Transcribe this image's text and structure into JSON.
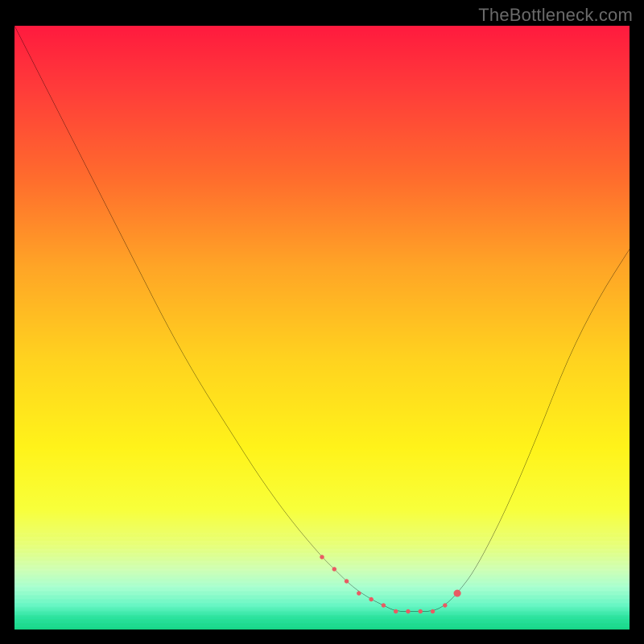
{
  "watermark": {
    "text": "TheBottleneck.com"
  },
  "chart_data": {
    "type": "line",
    "title": "",
    "xlabel": "",
    "ylabel": "",
    "xlim": [
      0,
      100
    ],
    "ylim": [
      0,
      100
    ],
    "grid": false,
    "legend": false,
    "series": [
      {
        "name": "bottleneck-curve",
        "color": "#000000",
        "x": [
          0,
          5,
          10,
          15,
          20,
          25,
          30,
          35,
          40,
          45,
          50,
          52,
          55,
          58,
          60,
          62,
          65,
          68,
          70,
          72,
          75,
          80,
          85,
          90,
          95,
          100
        ],
        "values": [
          100,
          90,
          80,
          70,
          60,
          50,
          41,
          33,
          25,
          18,
          12,
          10,
          7,
          5,
          4,
          3,
          3,
          3,
          4,
          6,
          10,
          20,
          32,
          45,
          55,
          63
        ]
      }
    ],
    "markers": {
      "name": "emphasis-dots",
      "color": "#e85c63",
      "radius_small": 3,
      "radius_end": 5,
      "x": [
        50,
        52,
        54,
        56,
        58,
        60,
        62,
        64,
        66,
        68,
        70,
        72
      ],
      "values": [
        12,
        10,
        8,
        6,
        5,
        4,
        3,
        3,
        3,
        3,
        4,
        6
      ]
    },
    "background_gradient": {
      "stops": [
        {
          "pos": 0,
          "color": "#ff1a3e"
        },
        {
          "pos": 25,
          "color": "#ff6b2d"
        },
        {
          "pos": 55,
          "color": "#ffd21f"
        },
        {
          "pos": 80,
          "color": "#f8ff3a"
        },
        {
          "pos": 100,
          "color": "#17d688"
        }
      ]
    }
  }
}
